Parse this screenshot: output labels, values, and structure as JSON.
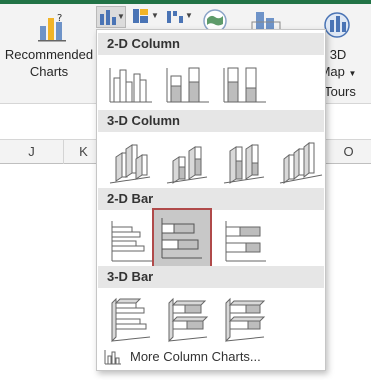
{
  "ribbon": {
    "recommended_charts_label_line1": "Recommended",
    "recommended_charts_label_line2": "Charts",
    "three_d_map_line1": "3D",
    "three_d_map_line2": "Map",
    "tours_label": "Tours"
  },
  "columns": [
    "J",
    "K",
    "O"
  ],
  "menu": {
    "sections": [
      {
        "title": "2-D Column"
      },
      {
        "title": "3-D Column"
      },
      {
        "title": "2-D Bar"
      },
      {
        "title": "3-D Bar"
      }
    ],
    "more_label": "More Column Charts..."
  },
  "colors": {
    "accent_green": "#217346",
    "selected_border": "#b04a4a",
    "selected_fill": "#c8c8c8"
  }
}
